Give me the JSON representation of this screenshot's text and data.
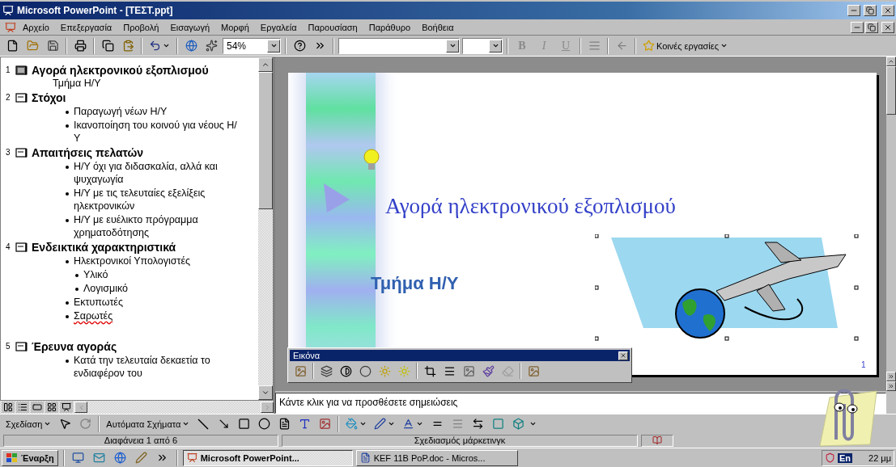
{
  "window": {
    "title": "Microsoft PowerPoint - [ΤΕΣΤ.ppt]"
  },
  "menu": [
    "Αρχείο",
    "Επεξεργασία",
    "Προβολή",
    "Εισαγωγή",
    "Μορφή",
    "Εργαλεία",
    "Παρουσίαση",
    "Παράθυρο",
    "Βοήθεια"
  ],
  "toolbar": {
    "zoom": "54%",
    "format_buttons": [
      {
        "label": "B",
        "disabled": true
      },
      {
        "label": "I",
        "disabled": true
      },
      {
        "label": "U",
        "disabled": true
      }
    ],
    "tasks_label": "Κοινές εργασίες"
  },
  "outline": {
    "slides": [
      {
        "number": "1",
        "title": "Αγορά ηλεκτρονικού εξοπλισμού",
        "selected": true,
        "subtitle": "Τμήμα Η/Υ"
      },
      {
        "number": "2",
        "title": "Στόχοι",
        "selected": false,
        "bullets": [
          {
            "text": "Παραγωγή νέων Η/Υ",
            "misspelled": false
          },
          {
            "text": "Ικανοποίηση του κοινού για νέους Η/Υ",
            "misspelled": false
          }
        ]
      },
      {
        "number": "3",
        "title": "Απαιτήσεις πελατών",
        "selected": false,
        "bullets": [
          {
            "text": "Η/Υ όχι για διδασκαλία, αλλά και ψυχαγωγία",
            "misspelled": false
          },
          {
            "text": "Η/Υ με τις τελευταίες εξελίξεις ηλεκτρονικών",
            "misspelled": false
          },
          {
            "text": "Η/Υ με ευέλικτο πρόγραμμα χρηματοδότησης",
            "misspelled": false
          }
        ]
      },
      {
        "number": "4",
        "title": "Ενδεικτικά χαρακτηριστικά",
        "selected": false,
        "bullets": [
          {
            "text": "Ηλεκτρονικοί Υπολογιστές",
            "misspelled": false,
            "children": [
              {
                "text": "Υλικό",
                "misspelled": false
              },
              {
                "text": "Λογισμικό",
                "misspelled": false
              }
            ]
          },
          {
            "text": "Εκτυπωτές",
            "misspelled": false
          },
          {
            "text": "Σαρωτές",
            "misspelled": true
          }
        ]
      },
      {
        "number": "5",
        "title": "Έρευνα αγοράς",
        "selected": false,
        "bullets": [
          {
            "text": "Κατά την τελευταία δεκαετία το ενδιαφέρον του",
            "misspelled": false
          }
        ]
      }
    ]
  },
  "slide": {
    "title": "Αγορά ηλεκτρονικού εξοπλισμού",
    "subtitle": "Τμήμα Η/Υ",
    "number": "1"
  },
  "picture_toolbar": {
    "title": "Εικόνα"
  },
  "notes": {
    "prompt": "Κάντε κλικ για να προσθέσετε σημειώσεις"
  },
  "drawing_toolbar": {
    "draw_label": "Σχεδίαση",
    "autoshapes_label": "Αυτόματα Σχήματα"
  },
  "status_bar": {
    "slide": "Διαφάνεια 1 από 6",
    "design": "Σχεδιασμός μάρκετινγκ"
  },
  "taskbar": {
    "start": "Έναρξη",
    "tasks": [
      {
        "label": "Microsoft PowerPoint...",
        "selected": true
      },
      {
        "label": "KEF 11B PoP.doc - Micros...",
        "selected": false
      }
    ],
    "language": "En",
    "clock": "22 μμ"
  }
}
